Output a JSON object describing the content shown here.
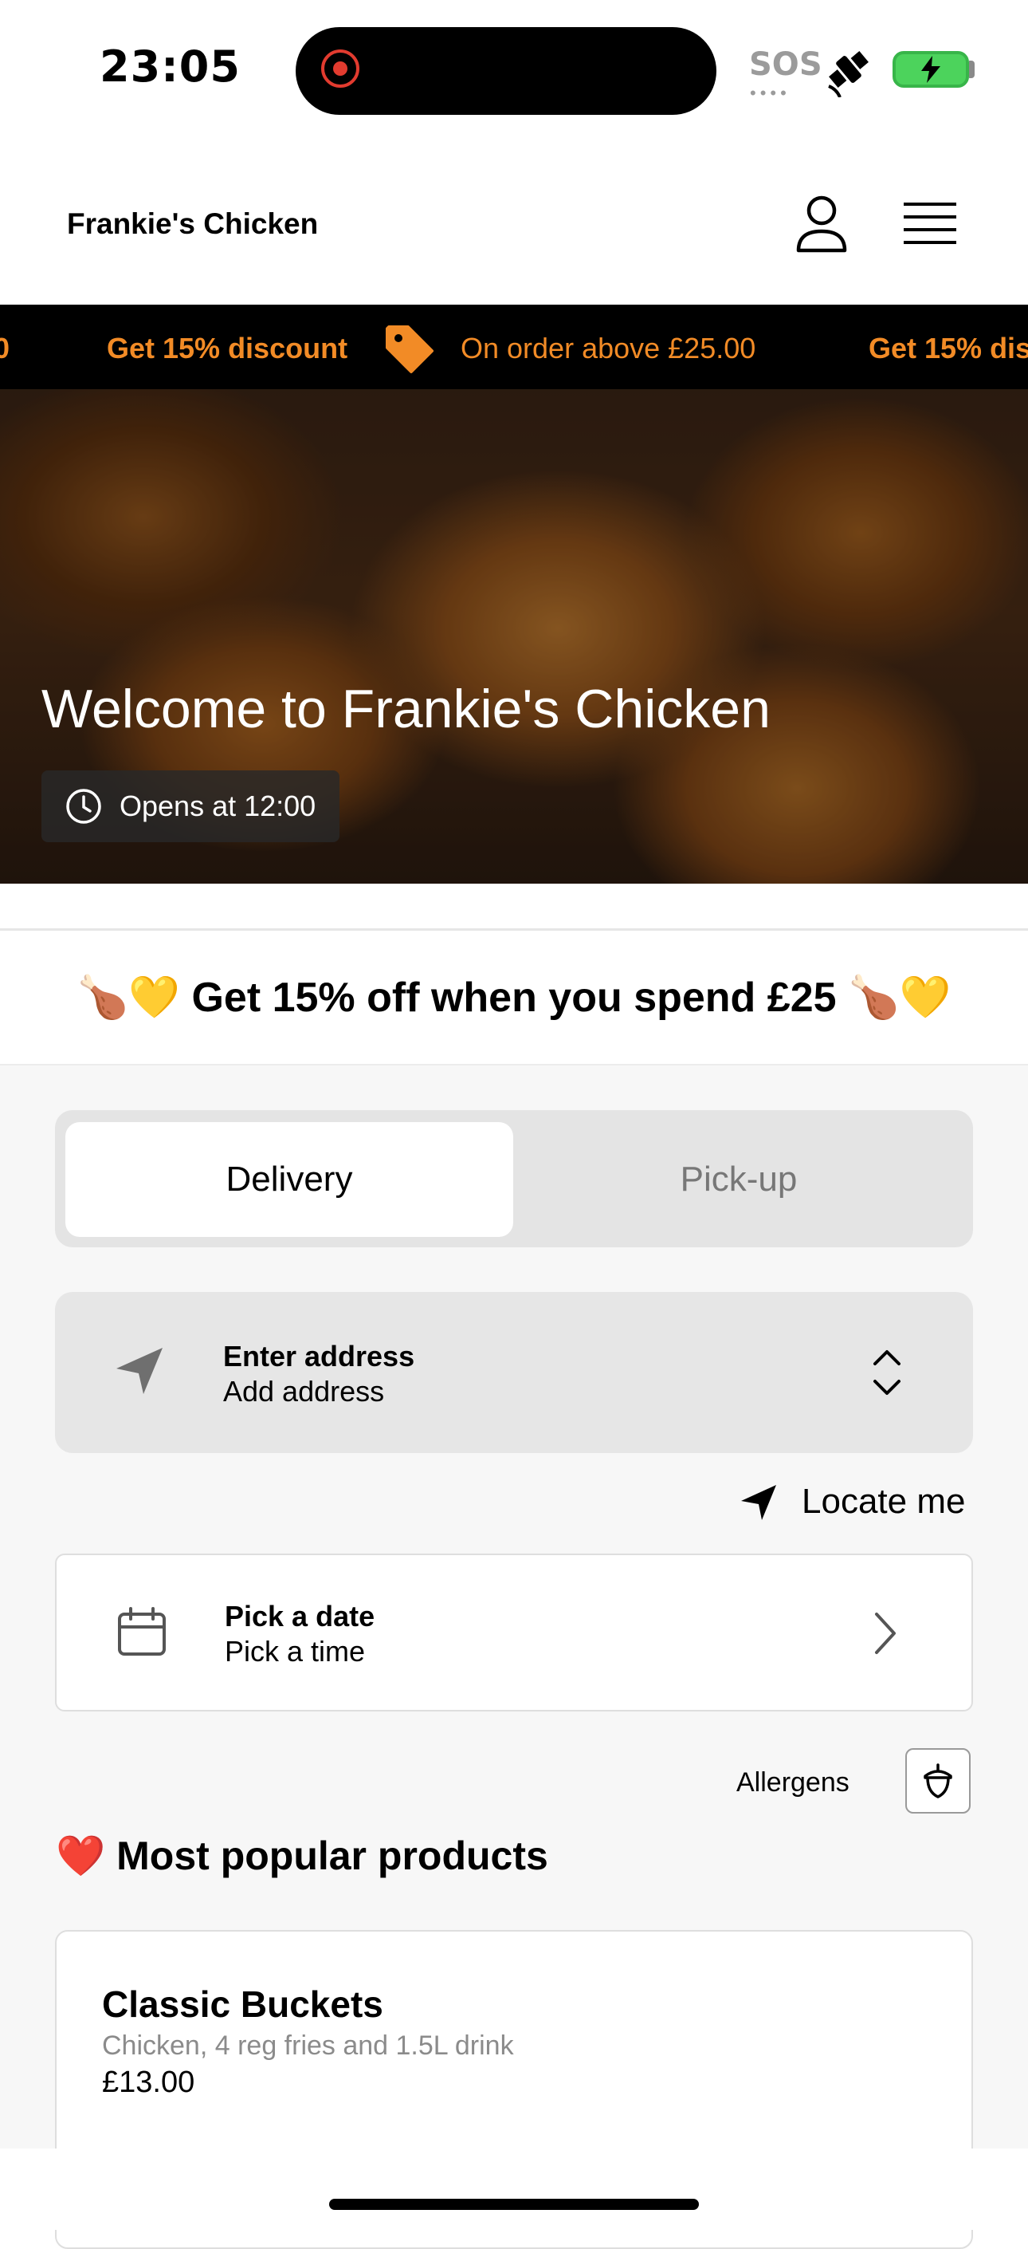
{
  "status_bar": {
    "time": "23:05",
    "sos": "SOS",
    "sos_dots": "••••"
  },
  "header": {
    "brand": "Frankie's Chicken"
  },
  "ticker": {
    "left_fragment": "0",
    "discount": "Get 15% discount",
    "condition": "On order above £25.00",
    "discount_repeat": "Get 15% dis"
  },
  "hero": {
    "title": "Welcome to Frankie's Chicken",
    "hours": "Opens at 12:00"
  },
  "banner": {
    "text": "🍗💛 Get 15% off when you spend £25 🍗💛"
  },
  "order_mode": {
    "delivery": "Delivery",
    "pickup": "Pick-up",
    "selected": "Delivery"
  },
  "address": {
    "title": "Enter address",
    "subtitle": "Add address"
  },
  "locate": {
    "label": "Locate me"
  },
  "schedule": {
    "title": "Pick a date",
    "subtitle": "Pick a time"
  },
  "allergens": {
    "label": "Allergens"
  },
  "popular": {
    "title": "❤️ Most popular products",
    "products": [
      {
        "name": "Classic Buckets",
        "description": "Chicken, 4 reg fries and 1.5L drink",
        "price": "£13.00"
      }
    ]
  },
  "colors": {
    "accent": "#f28b26",
    "ticker_bg": "#000000",
    "battery": "#4cd35c"
  }
}
